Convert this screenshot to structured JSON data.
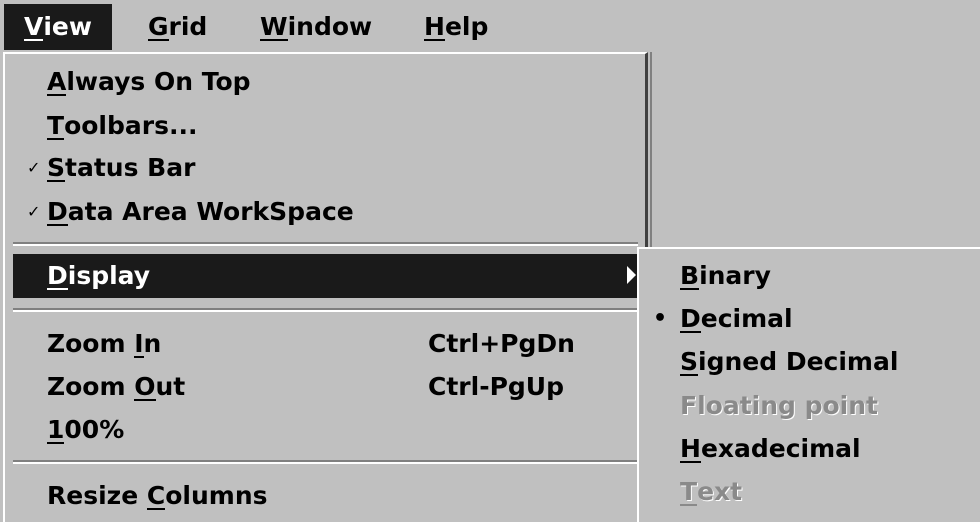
{
  "menubar": {
    "items": [
      {
        "pre": "",
        "u": "V",
        "post": "iew"
      },
      {
        "pre": "",
        "u": "G",
        "post": "rid"
      },
      {
        "pre": "",
        "u": "W",
        "post": "indow"
      },
      {
        "pre": "",
        "u": "H",
        "post": "elp"
      }
    ]
  },
  "view_menu": {
    "items": [
      {
        "pre": "",
        "u": "A",
        "post": "lways On Top",
        "accel": "",
        "check": ""
      },
      {
        "pre": "",
        "u": "T",
        "post": "oolbars...",
        "accel": "",
        "check": ""
      },
      {
        "pre": "",
        "u": "S",
        "post": "tatus Bar",
        "accel": "",
        "check": "✓"
      },
      {
        "pre": "",
        "u": "D",
        "post": "ata Area WorkSpace",
        "accel": "",
        "check": "✓"
      },
      {
        "pre": "",
        "u": "D",
        "post": "isplay",
        "accel": "",
        "check": ""
      },
      {
        "pre": "Zoom ",
        "u": "I",
        "post": "n",
        "accel": "Ctrl+PgDn",
        "check": ""
      },
      {
        "pre": "Zoom ",
        "u": "O",
        "post": "ut",
        "accel": "Ctrl-PgUp",
        "check": ""
      },
      {
        "pre": "",
        "u": "1",
        "post": "00%",
        "accel": "",
        "check": ""
      },
      {
        "pre": "Resize ",
        "u": "C",
        "post": "olumns",
        "accel": "",
        "check": ""
      }
    ]
  },
  "display_submenu": {
    "items": [
      {
        "pre": "",
        "u": "B",
        "post": "inary",
        "bullet": ""
      },
      {
        "pre": "",
        "u": "D",
        "post": "ecimal",
        "bullet": "•"
      },
      {
        "pre": "",
        "u": "S",
        "post": "igned Decimal",
        "bullet": ""
      },
      {
        "pre": "Floating point",
        "u": "",
        "post": "",
        "bullet": ""
      },
      {
        "pre": "",
        "u": "H",
        "post": "exadecimal",
        "bullet": ""
      },
      {
        "pre": "",
        "u": "T",
        "post": "ext",
        "bullet": ""
      }
    ]
  }
}
